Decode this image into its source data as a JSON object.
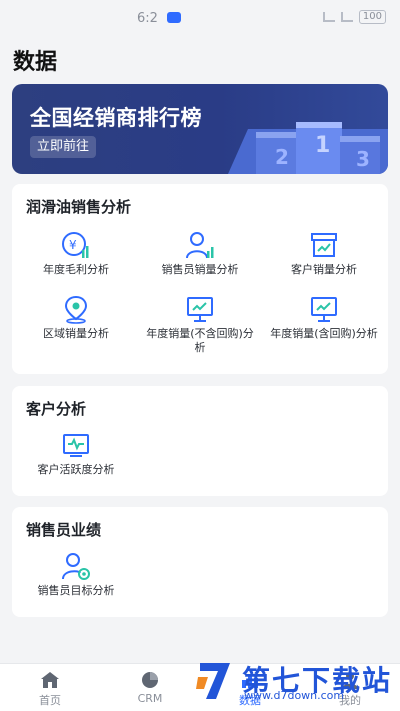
{
  "status": {
    "time": "6:2",
    "battery": "100"
  },
  "page_title": "数据",
  "banner": {
    "title": "全国经销商排行榜",
    "button": "立即前往",
    "podium": [
      "2",
      "1",
      "3"
    ]
  },
  "lubricant": {
    "title": "润滑油销售分析",
    "items": [
      {
        "label": "年度毛利分析",
        "icon": "yuan-chart-icon"
      },
      {
        "label": "销售员销量分析",
        "icon": "user-chart-icon"
      },
      {
        "label": "客户销量分析",
        "icon": "box-chart-icon"
      },
      {
        "label": "区域销量分析",
        "icon": "location-icon"
      },
      {
        "label": "年度销量(不含回购)分析",
        "icon": "monitor-trend-icon"
      },
      {
        "label": "年度销量(含回购)分析",
        "icon": "monitor-trend-icon"
      }
    ]
  },
  "customer": {
    "title": "客户分析",
    "items": [
      {
        "label": "客户活跃度分析",
        "icon": "activity-icon"
      }
    ]
  },
  "sales": {
    "title": "销售员业绩",
    "items": [
      {
        "label": "销售员目标分析",
        "icon": "user-target-icon"
      }
    ]
  },
  "tabs": [
    {
      "label": "首页",
      "icon": "home-icon"
    },
    {
      "label": "CRM",
      "icon": "pie-icon"
    },
    {
      "label": "数据",
      "icon": "data-icon"
    },
    {
      "label": "我的",
      "icon": "user-icon"
    }
  ],
  "watermark": {
    "name": "第七下载站",
    "url": "www.d7down.com"
  },
  "colors": {
    "accent": "#2f6bff",
    "banner": "#2d3f80",
    "icon_teal": "#2ac4a8"
  }
}
